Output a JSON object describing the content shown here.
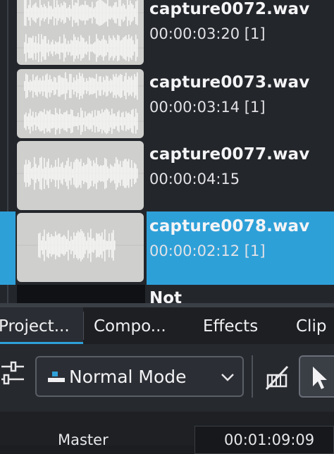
{
  "project_bin": {
    "clips": [
      {
        "name": "capture0072.wav",
        "duration": "00:00:03:20 [1]",
        "selected": false
      },
      {
        "name": "capture0073.wav",
        "duration": "00:00:03:14 [1]",
        "selected": false
      },
      {
        "name": "capture0077.wav",
        "duration": "00:00:04:15",
        "selected": false
      },
      {
        "name": "capture0078.wav",
        "duration": "00:00:02:12 [1]",
        "selected": true
      }
    ],
    "partial_clip_name": "Not"
  },
  "tabs": [
    {
      "label": "Project...",
      "active": true
    },
    {
      "label": "Compo...",
      "active": false
    },
    {
      "label": "Effects",
      "active": false
    },
    {
      "label": "Clip",
      "active": false
    }
  ],
  "toolbar": {
    "mode_label": "Normal Mode",
    "mode_icon": "normal-mode-icon",
    "settings_icon": "sliders-icon",
    "razor_icon": "razor-tool-icon",
    "select_icon": "select-tool-icon"
  },
  "mixer": {
    "master_label": "Master",
    "timecode": "00:01:09:09"
  },
  "colors": {
    "accent": "#2ea0d8",
    "panel": "#23262b",
    "waveform_bg": "#cfcfcd",
    "waveform": "#f7f7f5"
  }
}
